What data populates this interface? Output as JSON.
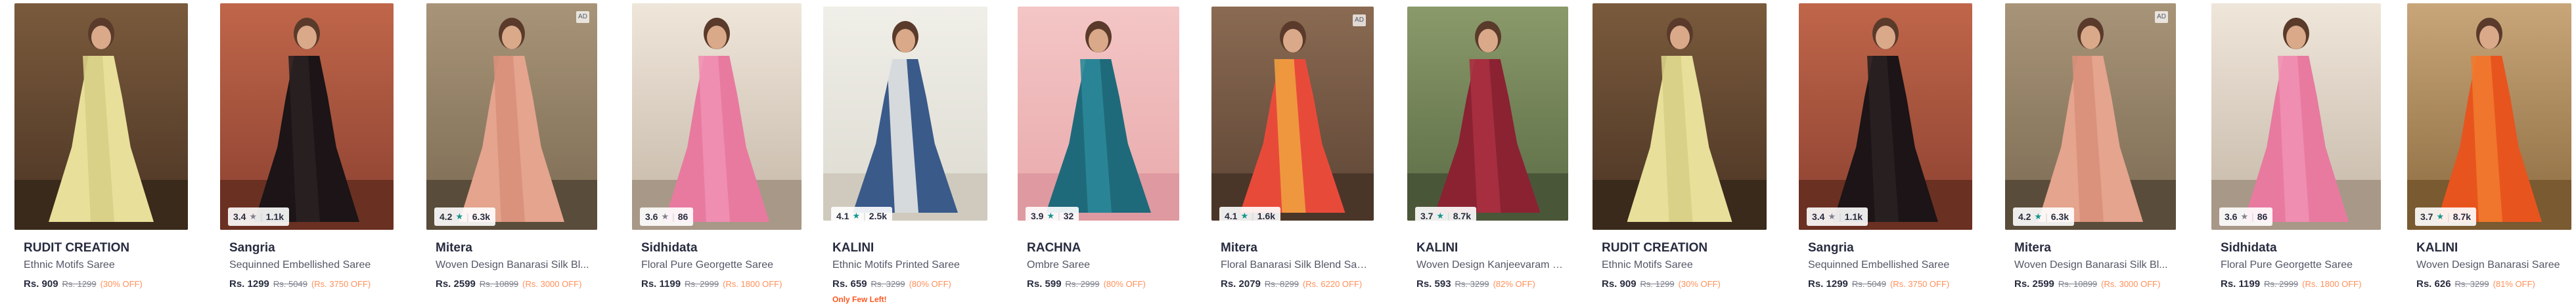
{
  "products": [
    {
      "brand": "RUDIT CREATION",
      "desc": "Ethnic Motifs Saree",
      "price": "Rs. 909",
      "mrp": "Rs. 1299",
      "off": "(30% OFF)",
      "rating": "",
      "count": ""
    },
    {
      "brand": "Sangria",
      "desc": "Sequinned Embellished Saree",
      "price": "Rs. 1299",
      "mrp": "Rs. 5049",
      "off": "(Rs. 3750 OFF)",
      "rating": "3.4",
      "count": "1.1k",
      "star_color": "#7e818c"
    },
    {
      "brand": "Mitera",
      "desc": "Woven Design Banarasi Silk Bl...",
      "price": "Rs. 2599",
      "mrp": "Rs. 10899",
      "off": "(Rs. 3000 OFF)",
      "rating": "4.2",
      "count": "6.3k",
      "star_color": "#14958f",
      "ad": "AD"
    },
    {
      "brand": "Sidhidata",
      "desc": "Floral Pure Georgette Saree",
      "price": "Rs. 1199",
      "mrp": "Rs. 2999",
      "off": "(Rs. 1800 OFF)",
      "rating": "3.6",
      "count": "86",
      "star_color": "#7e818c"
    },
    {
      "brand": "KALINI",
      "desc": "Ethnic Motifs Printed Saree",
      "price": "Rs. 659",
      "mrp": "Rs. 3299",
      "off": "(80% OFF)",
      "rating": "4.1",
      "count": "2.5k",
      "star_color": "#14958f",
      "few": "Only Few Left!"
    },
    {
      "brand": "RACHNA",
      "desc": "Ombre Saree",
      "price": "Rs. 599",
      "mrp": "Rs. 2999",
      "off": "(80% OFF)",
      "rating": "3.9",
      "count": "32",
      "star_color": "#14958f"
    },
    {
      "brand": "Mitera",
      "desc": "Floral Banarasi Silk Blend Saree",
      "price": "Rs. 2079",
      "mrp": "Rs. 8299",
      "off": "(Rs. 6220 OFF)",
      "rating": "4.1",
      "count": "1.6k",
      "star_color": "#14958f",
      "ad": "AD"
    },
    {
      "brand": "KALINI",
      "desc": "Woven Design Kanjeevaram S...",
      "price": "Rs. 593",
      "mrp": "Rs. 3299",
      "off": "(82% OFF)",
      "rating": "3.7",
      "count": "8.7k",
      "star_color": "#14958f"
    },
    {
      "brand": "RUDIT CREATION",
      "desc": "Ethnic Motifs Saree",
      "price": "Rs. 909",
      "mrp": "Rs. 1299",
      "off": "(30% OFF)",
      "rating": "",
      "count": ""
    },
    {
      "brand": "Sangria",
      "desc": "Sequinned Embellished Saree",
      "price": "Rs. 1299",
      "mrp": "Rs. 5049",
      "off": "(Rs. 3750 OFF)",
      "rating": "3.4",
      "count": "1.1k",
      "star_color": "#7e818c"
    },
    {
      "brand": "Mitera",
      "desc": "Woven Design Banarasi Silk Bl...",
      "price": "Rs. 2599",
      "mrp": "Rs. 10899",
      "off": "(Rs. 3000 OFF)",
      "rating": "4.2",
      "count": "6.3k",
      "star_color": "#14958f",
      "ad": "AD"
    },
    {
      "brand": "Sidhidata",
      "desc": "Floral Pure Georgette Saree",
      "price": "Rs. 1199",
      "mrp": "Rs. 2999",
      "off": "(Rs. 1800 OFF)",
      "rating": "3.6",
      "count": "86",
      "star_color": "#7e818c"
    },
    {
      "brand": "KALINI",
      "desc": "Woven Design Banarasi Saree",
      "price": "Rs. 626",
      "mrp": "Rs. 3299",
      "off": "(81% OFF)",
      "rating": "3.7",
      "count": "8.7k",
      "star_color": "#14958f"
    }
  ],
  "colors": {
    "accent_off": "#ff905a",
    "few_left": "#ff5722",
    "star_good": "#14958f",
    "star_neutral": "#7e818c"
  },
  "icons": {
    "star": "star-icon",
    "ad": "ad-badge"
  }
}
